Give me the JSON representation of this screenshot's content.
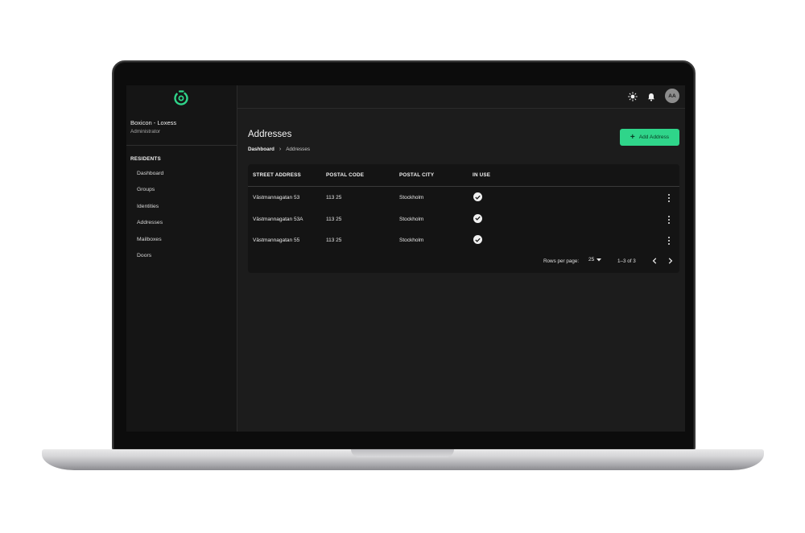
{
  "app": {
    "org_name": "Boxicon - Loxess",
    "org_role": "Administrator",
    "brand_color": "#2fd58a"
  },
  "sidebar": {
    "section_title": "RESIDENTS",
    "items": [
      {
        "label": "Dashboard"
      },
      {
        "label": "Groups"
      },
      {
        "label": "Identities"
      },
      {
        "label": "Addresses"
      },
      {
        "label": "Mailboxes"
      },
      {
        "label": "Doors"
      }
    ]
  },
  "topbar": {
    "icons": [
      "sun-icon",
      "bell-icon"
    ],
    "avatar_initials": "AA"
  },
  "page": {
    "title": "Addresses",
    "breadcrumb": {
      "root": "Dashboard",
      "separator": "›",
      "current": "Addresses"
    },
    "add_button_label": "Add Address"
  },
  "table": {
    "columns": [
      "STREET ADDRESS",
      "POSTAL CODE",
      "POSTAL CITY",
      "IN USE"
    ],
    "rows": [
      {
        "street": "Västmannagatan 53",
        "postal_code": "113 25",
        "city": "Stockholm",
        "in_use": true
      },
      {
        "street": "Västmannagatan 53A",
        "postal_code": "113 25",
        "city": "Stockholm",
        "in_use": true
      },
      {
        "street": "Västmannagatan 55",
        "postal_code": "113 25",
        "city": "Stockholm",
        "in_use": true
      }
    ],
    "pagination": {
      "rows_per_page_label": "Rows per page:",
      "rows_per_page": "25",
      "range": "1–3 of 3"
    }
  }
}
